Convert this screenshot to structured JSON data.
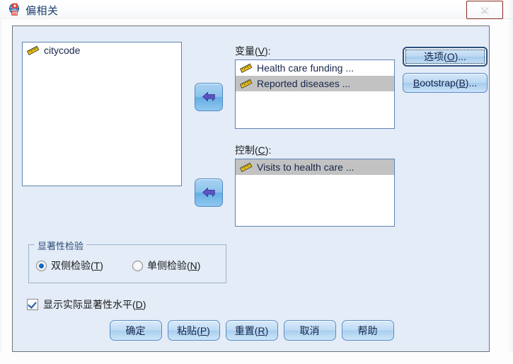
{
  "window": {
    "title": "偏相关",
    "app_icon": "spss-partial-correlation-icon",
    "close_label": "✕"
  },
  "source_list": {
    "name": "source-variable-list",
    "items": [
      {
        "label": "citycode",
        "icon": "scale-ruler-icon",
        "selected": false
      }
    ]
  },
  "transfer_buttons": [
    {
      "name": "move-to-variables-button",
      "icon": "arrow-left-icon"
    },
    {
      "name": "move-to-controls-button",
      "icon": "arrow-left-icon"
    }
  ],
  "variables": {
    "label_prefix": "变量(",
    "label_mnemonic": "V",
    "label_suffix": "):",
    "items": [
      {
        "label": "Health care funding ...",
        "icon": "scale-ruler-icon",
        "selected": false
      },
      {
        "label": "Reported diseases ...",
        "icon": "scale-ruler-icon",
        "selected": true
      }
    ]
  },
  "controls": {
    "label_prefix": "控制(",
    "label_mnemonic": "C",
    "label_suffix": "):",
    "items": [
      {
        "label": "Visits to health care ...",
        "icon": "scale-ruler-icon",
        "selected": true
      }
    ]
  },
  "side_buttons": [
    {
      "name": "options-button",
      "prefix": "选项(",
      "mnemonic": "O",
      "suffix": ")...",
      "focused": true
    },
    {
      "name": "bootstrap-button",
      "prefix": "",
      "mnemonic": "B",
      "suffix": "ootstrap(B)...",
      "focused": false
    }
  ],
  "bootstrap_button_text": {
    "lead": "B",
    "rest": "ootstrap(",
    "mnemonic": "B",
    "tail": ")..."
  },
  "significance_group": {
    "title": "显著性检验",
    "options": [
      {
        "name": "two-tailed-radio",
        "prefix": "双侧检验(",
        "mnemonic": "T",
        "suffix": ")",
        "checked": true
      },
      {
        "name": "one-tailed-radio",
        "prefix": "单侧检验(",
        "mnemonic": "N",
        "suffix": ")",
        "checked": false
      }
    ]
  },
  "display_actual_significance": {
    "name": "display-actual-significance-checkbox",
    "prefix": "显示实际显著性水平(",
    "mnemonic": "D",
    "suffix": ")",
    "checked": true
  },
  "bottom_buttons": [
    {
      "name": "ok-button",
      "prefix": "确定",
      "mnemonic": "",
      "suffix": ""
    },
    {
      "name": "paste-button",
      "prefix": "粘贴(",
      "mnemonic": "P",
      "suffix": ")"
    },
    {
      "name": "reset-button",
      "prefix": "重置(",
      "mnemonic": "R",
      "suffix": ")"
    },
    {
      "name": "cancel-button",
      "prefix": "取消",
      "mnemonic": "",
      "suffix": ""
    },
    {
      "name": "help-button",
      "prefix": "帮助",
      "mnemonic": "",
      "suffix": ""
    }
  ],
  "colors": {
    "panel_bg": "#e3ecf7",
    "list_border": "#5f84b1",
    "selection": "#c2c2c2",
    "close_red": "#cf5440",
    "title_text": "#1b3d6d",
    "ruler_gold": "#f5c518"
  }
}
